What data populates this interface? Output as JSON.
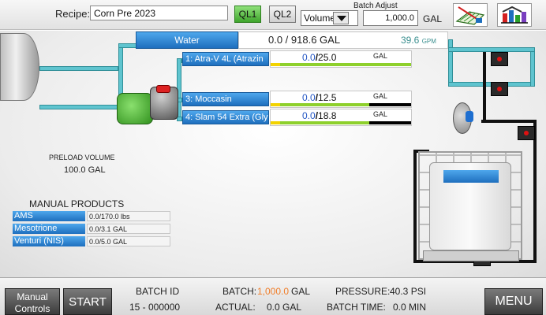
{
  "header": {
    "recipe_label": "Recipe:",
    "recipe_value": "Corn Pre 2023",
    "ql1": "QL1",
    "ql2": "QL2",
    "batch_adjust_title": "Batch Adjust",
    "mode_value": "Volume",
    "adjust_value": "1,000.0",
    "adjust_unit": "GAL",
    "field_icon": "field-map-icon",
    "chart_icon": "tank-chart-icon"
  },
  "water": {
    "label": "Water",
    "amount": "0.0 / 918.6 GAL",
    "rate": "39.6",
    "rate_unit": "GPM"
  },
  "products": [
    {
      "label": "1: Atra-V 4L (Atrazin",
      "current": "0.0",
      "target": "25.0",
      "unit": "GAL",
      "fill": 1.0
    },
    {
      "label": "3: Moccasin",
      "current": "0.0",
      "target": "12.5",
      "unit": "GAL",
      "fill": 0.7
    },
    {
      "label": "4: Slam 54 Extra (Gly",
      "current": "0.0",
      "target": "18.8",
      "unit": "GAL",
      "fill": 0.7
    }
  ],
  "preload": {
    "label": "PRELOAD VOLUME",
    "value": "100.0 GAL"
  },
  "manual_products": {
    "title": "MANUAL PRODUCTS",
    "items": [
      {
        "name": "AMS",
        "value": "0.0/170.0 lbs"
      },
      {
        "name": "Mesotrione",
        "value": "0.0/3.1 GAL"
      },
      {
        "name": "Venturi (NIS)",
        "value": "0.0/5.0 GAL"
      }
    ]
  },
  "footer": {
    "manual_controls_line1": "Manual",
    "manual_controls_line2": "Controls",
    "start": "START",
    "batch_id_label": "BATCH ID",
    "batch_id_value": "15 - 000000",
    "batch_label": "BATCH:",
    "batch_value": "1,000.0",
    "batch_unit": "GAL",
    "actual_label": "ACTUAL:",
    "actual_value": "0.0 GAL",
    "pressure_label": "PRESSURE:",
    "pressure_value": "40.3 PSI",
    "batch_time_label": "BATCH TIME:",
    "batch_time_value": "0.0 MIN",
    "menu": "MENU"
  },
  "colors": {
    "button_blue": "#1e6fbe",
    "ql_active": "#3fa52c",
    "product_fill": "#8ed02c",
    "product_stub": "#f2d300",
    "batch_orange": "#f07e2a",
    "pipe_teal": "#5fc4cf"
  }
}
